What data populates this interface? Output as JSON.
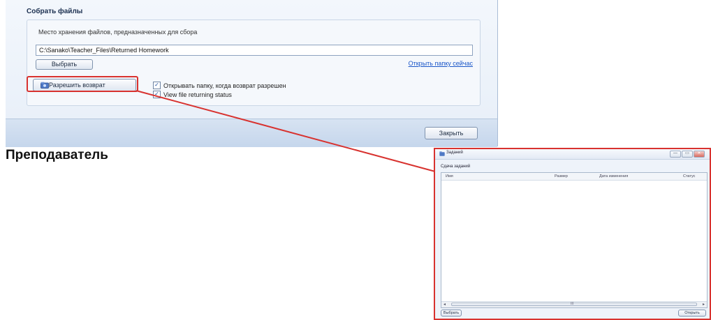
{
  "dialog": {
    "group_title": "Собрать файлы",
    "storage_label": "Место хранения файлов, предназначенных для сбора",
    "path_value": "C:\\Sanako\\Teacher_Files\\Returned Homework",
    "choose_button": "Выбрать",
    "open_folder_link": "Открыть папку сейчас",
    "allow_return_button": "Разрешить возврат",
    "checkboxes": [
      {
        "label": "Открывать папку, когда возврат разрешен",
        "checked": true
      },
      {
        "label": "View file returning status",
        "checked": true
      }
    ],
    "close_button": "Закрыть"
  },
  "caption": "Преподаватель",
  "assignments_window": {
    "title": "Заданий",
    "window_buttons": [
      "—",
      "▭",
      "✕"
    ],
    "section_label": "Сдача заданий",
    "columns": [
      "Имя",
      "Размер",
      "Дата изменения",
      "Статус"
    ],
    "scroll_label": "III",
    "choose_button": "Выбрать",
    "open_button": "Открыть"
  },
  "colors": {
    "highlight": "#d8322f",
    "link": "#1a56c8"
  },
  "icons": {
    "allow_return": "folder-return-icon",
    "window": "app-icon"
  }
}
